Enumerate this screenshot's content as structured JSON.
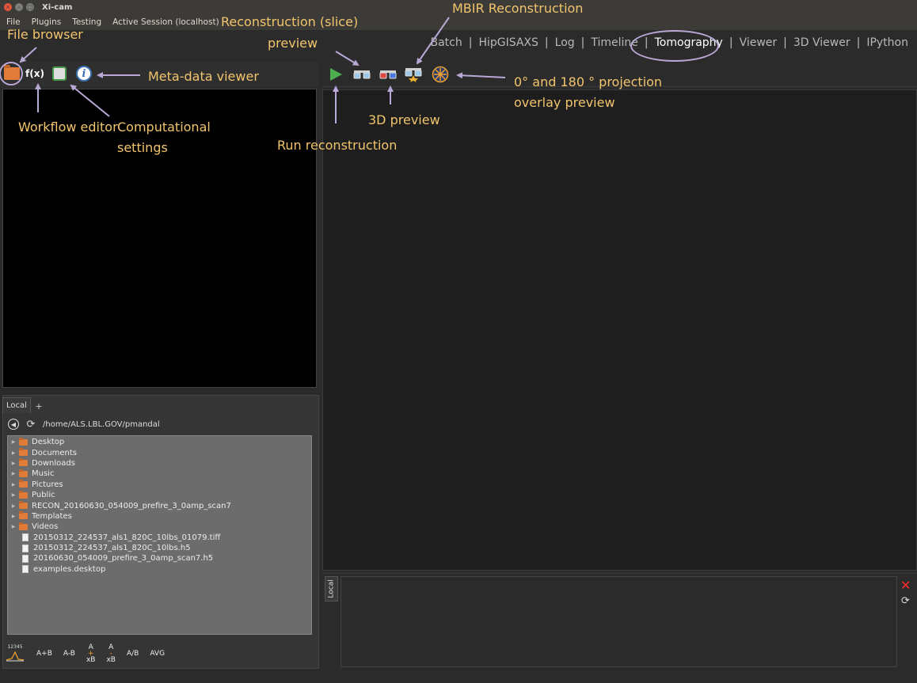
{
  "window": {
    "title": "Xi-cam"
  },
  "menu": [
    "File",
    "Plugins",
    "Testing",
    "Active Session (localhost)"
  ],
  "tabs": [
    {
      "label": "Batch"
    },
    {
      "label": "HipGISAXS"
    },
    {
      "label": "Log"
    },
    {
      "label": "Timeline"
    },
    {
      "label": "Tomography",
      "active": true
    },
    {
      "label": "Viewer"
    },
    {
      "label": "3D Viewer"
    },
    {
      "label": "IPython"
    }
  ],
  "left_toolbar": {
    "workflow_label": "f(x)",
    "info_label": "i"
  },
  "browser": {
    "tab": "Local",
    "add_tab": "+",
    "path": "/home/ALS.LBL.GOV/pmandal",
    "folders": [
      "Desktop",
      "Documents",
      "Downloads",
      "Music",
      "Pictures",
      "Public",
      "RECON_20160630_054009_prefire_3_0amp_scan7",
      "Templates",
      "Videos"
    ],
    "files": [
      "20150312_224537_als1_820C_10lbs_01079.tiff",
      "20150312_224537_als1_820C_10lbs.h5",
      "20160630_054009_prefire_3_0amp_scan7.h5",
      "examples.desktop"
    ]
  },
  "ops": {
    "scale_label": "12345",
    "a_plus_b": "A+B",
    "a_minus_b": "A-B",
    "a_plus_xb": [
      "A",
      "+",
      "xB"
    ],
    "a_minus_xb": [
      "A",
      "-",
      "xB"
    ],
    "a_div_b": "A/B",
    "avg": "AVG"
  },
  "right_bottom": {
    "tab": "Local"
  },
  "colors": {
    "accent": "#f2c46d",
    "arrow": "#b9a7d6",
    "play": "#4caf50",
    "close": "#ff2a2a"
  },
  "annotations": {
    "file_browser": "File browser",
    "meta_viewer": "Meta-data viewer",
    "workflow_editor": "Workflow editor",
    "computational_1": "Computational",
    "computational_2": "settings",
    "recon_slice_1": "Reconstruction (slice)",
    "recon_slice_2": "preview",
    "mbir": "MBIR Reconstruction",
    "projection_1": "0° and 180 ° projection",
    "projection_2": "overlay preview",
    "preview_3d": "3D preview",
    "run_recon": "Run reconstruction"
  }
}
